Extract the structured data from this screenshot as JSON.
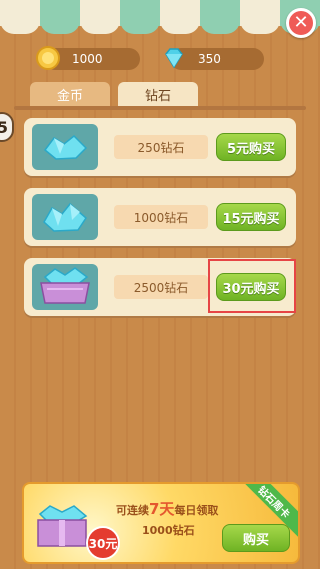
{
  "currency": {
    "gold": "1000",
    "diamonds": "350"
  },
  "tabs": [
    {
      "label": "金币"
    },
    {
      "label": "钻石"
    }
  ],
  "side": {
    "label": "5"
  },
  "rows": [
    {
      "amount": "250钻石",
      "button": "5元购买"
    },
    {
      "amount": "1000钻石",
      "button": "15元购买"
    },
    {
      "amount": "2500钻石",
      "button": "30元购买"
    }
  ],
  "promo": {
    "line1_pre": "可连续",
    "line1_big": "7天",
    "line1_post": "每日领取",
    "line2": "1000钻石",
    "price": "30元",
    "ribbon": "钻石周卡",
    "buy": "购买"
  },
  "icons": {
    "close": "close-icon",
    "coin": "gold-coin-icon",
    "diamond": "diamond-icon"
  },
  "colors": {
    "accent_green": "#6fb324",
    "highlight_red": "#e64545"
  }
}
